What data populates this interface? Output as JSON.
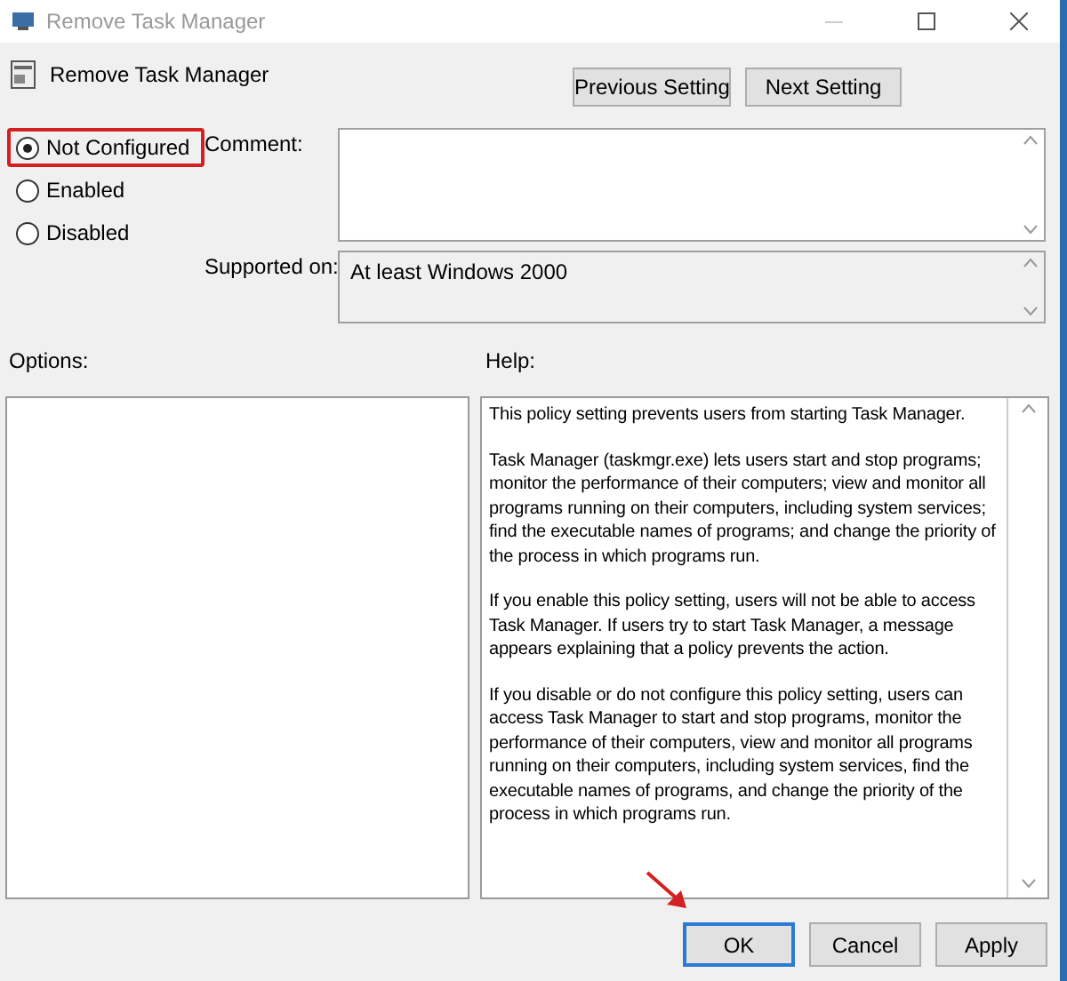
{
  "window": {
    "title": "Remove Task Manager"
  },
  "heading": "Remove Task Manager",
  "nav_buttons": [
    "Previous Setting",
    "Next Setting"
  ],
  "options": [
    {
      "label": "Not Configured",
      "selected": true,
      "highlighted": true
    },
    {
      "label": "Enabled",
      "selected": false,
      "highlighted": false
    },
    {
      "label": "Disabled",
      "selected": false,
      "highlighted": false
    }
  ],
  "comment": {
    "label": "Comment:"
  },
  "supported_on": {
    "label": "Supported on:",
    "value": "At least Windows 2000"
  },
  "options_label": "Options:",
  "help": {
    "label": "Help:",
    "paragraphs": [
      "This policy setting prevents users from starting Task Manager.",
      "Task Manager (taskmgr.exe) lets users start and stop programs; monitor the performance of their computers; view and monitor all programs running on their computers, including system services; find the executable names of programs; and change the priority of the process in which programs run.",
      "If you enable this policy setting, users will not be able to access Task Manager. If users try to start Task Manager, a message appears explaining that a policy prevents the action.",
      "If you disable or do not configure this policy setting, users can access Task Manager to  start and stop programs, monitor the performance of their computers, view and monitor all programs running on their computers, including system services, find the executable names of programs, and change the priority of the process in which programs run."
    ]
  },
  "buttons": [
    {
      "label": "OK",
      "default": true,
      "pointed": true
    },
    {
      "label": "Cancel",
      "default": false,
      "pointed": false
    },
    {
      "label": "Apply",
      "default": false,
      "pointed": false
    }
  ]
}
